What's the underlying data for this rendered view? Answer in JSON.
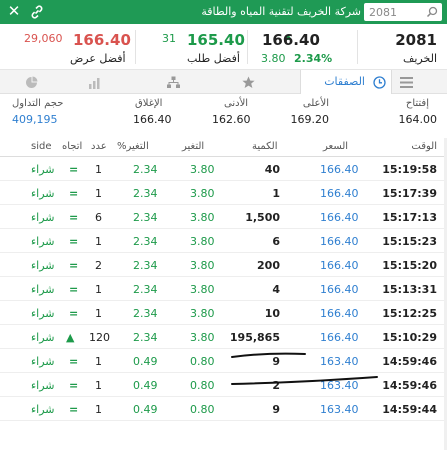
{
  "header": {
    "title": "شركة الخريف لتقنية المياه والطاقة",
    "search_value": "2081"
  },
  "quote": {
    "symbol": "2081",
    "symbol_name": "الخريف",
    "last_price": "166.40",
    "change": "3.80",
    "change_pct": "2.34%",
    "bid_qty": "31",
    "bid_price": "165.40",
    "bid_label": "أفضل طلب",
    "ask_qty": "29,060",
    "ask_price": "166.40",
    "ask_label": "أفضل عرض"
  },
  "tabs": [
    {
      "label": "الصفقات",
      "icon": "clock-icon",
      "active": true
    },
    {
      "label": "",
      "icon": "list-icon"
    },
    {
      "label": "",
      "icon": "star-icon"
    },
    {
      "label": "",
      "icon": "network-icon"
    },
    {
      "label": "",
      "icon": "bar-chart-icon"
    },
    {
      "label": "",
      "icon": "pie-chart-icon"
    }
  ],
  "stats": {
    "open_label": "إفتتاح",
    "open": "164.00",
    "high_label": "الأعلى",
    "high": "169.20",
    "low_label": "الأدنى",
    "low": "162.60",
    "close_label": "الإغلاق",
    "close": "166.40",
    "volume_label": "حجم التداول",
    "volume": "409,195"
  },
  "table": {
    "headers": {
      "time": "الوقت",
      "price": "السعر",
      "qty": "الكمية",
      "change": "التغير",
      "change_pct": "%التغير",
      "count": "عدد",
      "direction": "اتجاه",
      "side": "side"
    },
    "rows": [
      {
        "time": "15:19:58",
        "price": "166.40",
        "qty": "40",
        "change": "3.80",
        "change_pct": "2.34",
        "count": "1",
        "dir": "=",
        "side": "شراء"
      },
      {
        "time": "15:17:39",
        "price": "166.40",
        "qty": "1",
        "change": "3.80",
        "change_pct": "2.34",
        "count": "1",
        "dir": "=",
        "side": "شراء"
      },
      {
        "time": "15:17:13",
        "price": "166.40",
        "qty": "1,500",
        "change": "3.80",
        "change_pct": "2.34",
        "count": "6",
        "dir": "=",
        "side": "شراء"
      },
      {
        "time": "15:15:23",
        "price": "166.40",
        "qty": "6",
        "change": "3.80",
        "change_pct": "2.34",
        "count": "1",
        "dir": "=",
        "side": "شراء"
      },
      {
        "time": "15:15:20",
        "price": "166.40",
        "qty": "200",
        "change": "3.80",
        "change_pct": "2.34",
        "count": "2",
        "dir": "=",
        "side": "شراء"
      },
      {
        "time": "15:13:31",
        "price": "166.40",
        "qty": "4",
        "change": "3.80",
        "change_pct": "2.34",
        "count": "1",
        "dir": "=",
        "side": "شراء"
      },
      {
        "time": "15:12:25",
        "price": "166.40",
        "qty": "10",
        "change": "3.80",
        "change_pct": "2.34",
        "count": "1",
        "dir": "=",
        "side": "شراء"
      },
      {
        "time": "15:10:29",
        "price": "166.40",
        "qty": "195,865",
        "change": "3.80",
        "change_pct": "2.34",
        "count": "120",
        "dir": "▲",
        "side": "شراء"
      },
      {
        "time": "14:59:46",
        "price": "163.40",
        "qty": "9",
        "change": "0.80",
        "change_pct": "0.49",
        "count": "1",
        "dir": "=",
        "side": "شراء"
      },
      {
        "time": "14:59:46",
        "price": "163.40",
        "qty": "2",
        "change": "0.80",
        "change_pct": "0.49",
        "count": "1",
        "dir": "=",
        "side": "شراء"
      },
      {
        "time": "14:59:44",
        "price": "163.40",
        "qty": "9",
        "change": "0.80",
        "change_pct": "0.49",
        "count": "1",
        "dir": "=",
        "side": "شراء"
      }
    ]
  },
  "colors": {
    "brand_green": "#1f9a55",
    "up_green": "#1d9a4a",
    "price_blue": "#2f7fd0",
    "down_red": "#d9534f"
  }
}
